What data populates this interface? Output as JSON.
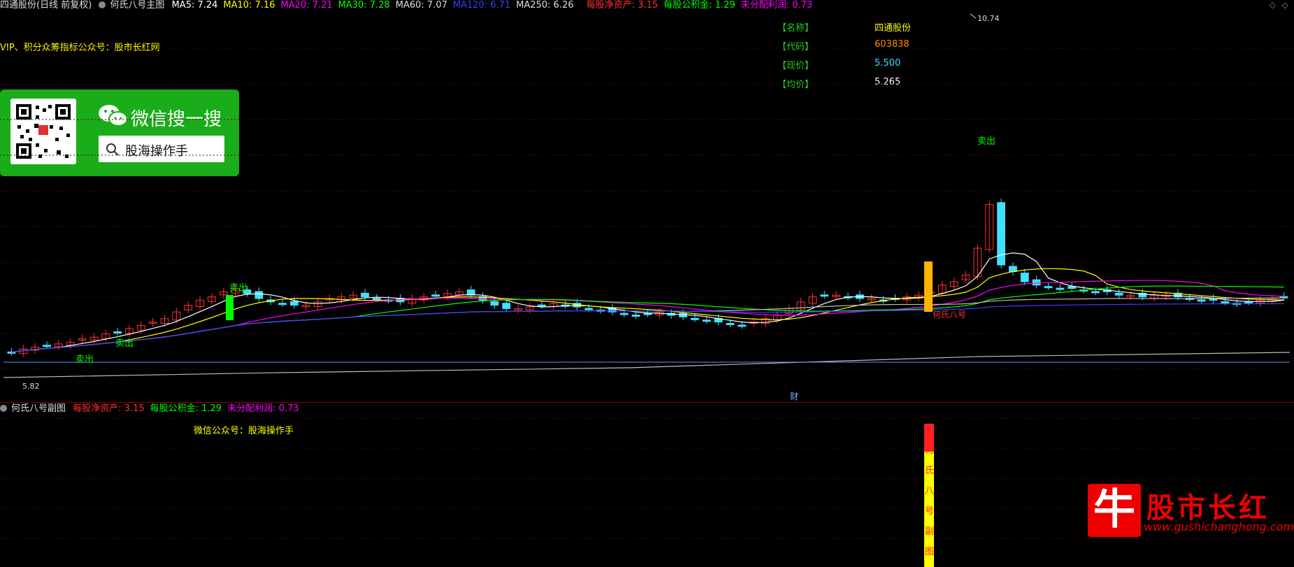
{
  "main_chart": {
    "header": {
      "stock_label": "四通股份(日线 前复权)",
      "indicator_name": "何氏八号主图",
      "ma_items": [
        {
          "text": "MA5: 7.24",
          "color": "#ffffff"
        },
        {
          "text": "MA10: 7.16",
          "color": "#ffff00"
        },
        {
          "text": "MA20: 7.21",
          "color": "#ff00ff"
        },
        {
          "text": "MA30: 7.28",
          "color": "#00ff00"
        },
        {
          "text": "MA60: 7.07",
          "color": "#dddddd"
        },
        {
          "text": "MA120: 6.71",
          "color": "#3b3bff"
        },
        {
          "text": "MA250: 6.26",
          "color": "#dddddd"
        }
      ],
      "fin_items": [
        {
          "text": "每股净资产: 3.15",
          "color": "#ff3030"
        },
        {
          "text": "每股公积金: 1.29",
          "color": "#00ff00"
        },
        {
          "text": "未分配利润: 0.73",
          "color": "#ff00ff"
        }
      ]
    },
    "promo_text": "VIP、积分众筹指标公众号：股市长红网",
    "info_panel": {
      "rows": [
        {
          "label": "【名称】",
          "value": "四通股份",
          "color": "#ffff00"
        },
        {
          "label": "【代码】",
          "value": "603838",
          "color": "#ff8c00"
        },
        {
          "label": "【现价】",
          "value": "5.500",
          "color": "#40e0ff"
        },
        {
          "label": "【均价】",
          "value": "5.265",
          "color": "#ffffff"
        }
      ]
    },
    "price_high_label": "10.74",
    "price_low_label": "5.82",
    "sell_label": "卖出",
    "signal_label": "何氏八号",
    "cai_label": "财"
  },
  "sub_chart": {
    "indicator_name": "何氏八号副图",
    "fin_items": [
      {
        "text": "每股净资产: 3.15",
        "color": "#ff3030"
      },
      {
        "text": "每股公积金: 1.29",
        "color": "#00ff00"
      },
      {
        "text": "未分配利润: 0.73",
        "color": "#ff00ff"
      }
    ],
    "promo_text": "微信公众号：股海操作手",
    "vertical_label": [
      "何",
      "氏",
      "八",
      "号",
      "副",
      "图"
    ]
  },
  "wechat_card": {
    "title": "微信搜一搜",
    "search_text": "股海操作手"
  },
  "watermark": {
    "logo_char": "牛",
    "title": "股市长红",
    "url": "www.gushichanghong.com"
  },
  "colors": {
    "bull": "#ff3030",
    "bear": "#40e0ff",
    "background": "#000000"
  }
}
